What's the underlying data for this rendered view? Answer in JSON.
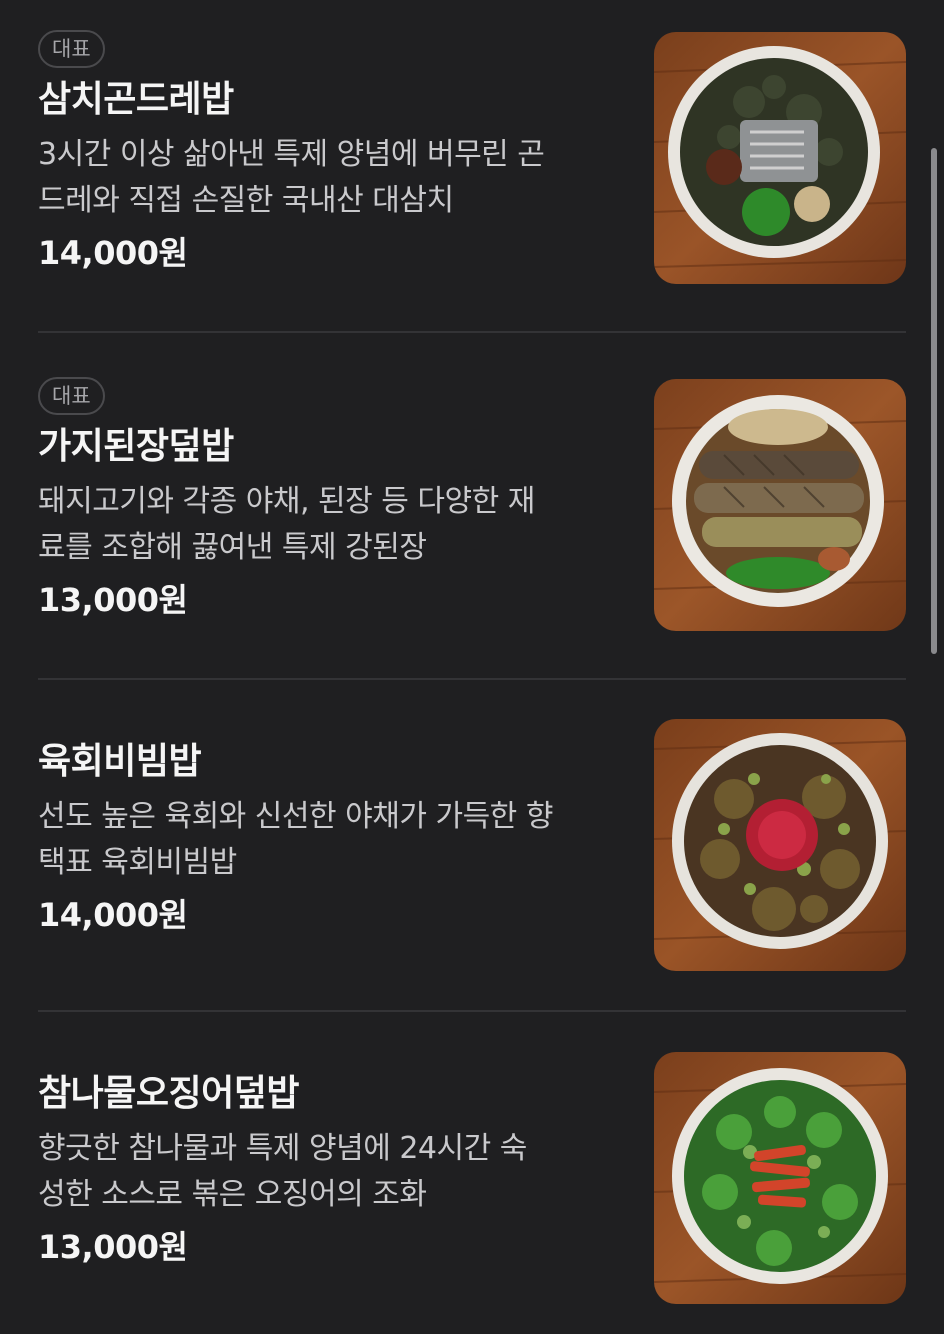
{
  "menu": {
    "items": [
      {
        "badge": "대표",
        "name": "삼치곤드레밥",
        "desc_line1": "3시간 이상 삶아낸 특제 양념에 버무린 곤",
        "desc_line2": "드레와 직접 손질한 국내산 대삼치",
        "price": "14,000원",
        "image_icon": "samchi-gondre-rice-bowl-photo"
      },
      {
        "badge": "대표",
        "name": "가지된장덮밥",
        "desc_line1": "돼지고기와 각종 야채, 된장 등 다양한 재",
        "desc_line2": "료를 조합해 끓여낸 특제 강된장",
        "price": "13,000원",
        "image_icon": "eggplant-doenjang-rice-bowl-photo"
      },
      {
        "name": "육회비빔밥",
        "desc_line1": "선도 높은 육회와 신선한 야채가 가득한 향",
        "desc_line2": "택표 육회비빔밥",
        "price": "14,000원",
        "image_icon": "yukhoe-bibimbap-photo"
      },
      {
        "name": "참나물오징어덮밥",
        "desc_line1": "향긋한 참나물과 특제 양념에 24시간 숙",
        "desc_line2": "성한 소스로 볶은 오징어의 조화",
        "price": "13,000원",
        "image_icon": "chamnamul-squid-rice-bowl-photo"
      }
    ]
  },
  "colors": {
    "background": "#1f1f21",
    "text_primary": "#f5f5f5",
    "text_secondary": "#c9c9cc",
    "badge_border": "#4a4a4d",
    "divider": "#333336",
    "wood": "#8a4a22"
  }
}
